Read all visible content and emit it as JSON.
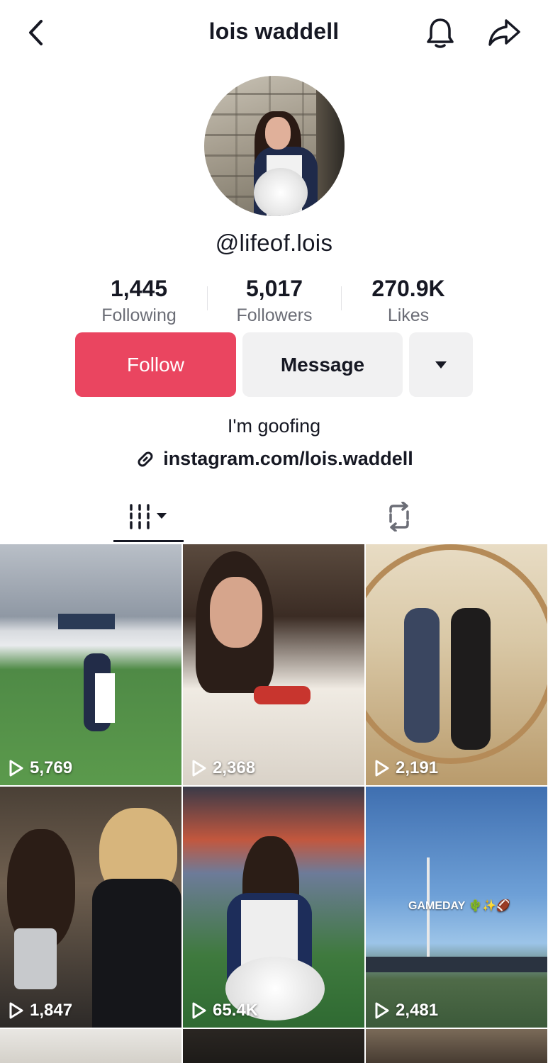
{
  "header": {
    "title": "lois waddell",
    "back_icon": "chevron-left-icon",
    "bell_icon": "bell-icon",
    "share_icon": "share-arrow-icon"
  },
  "profile": {
    "handle": "@lifeof.lois",
    "bio": "I'm goofing",
    "link": "instagram.com/lois.waddell"
  },
  "stats": {
    "following": {
      "value": "1,445",
      "label": "Following"
    },
    "followers": {
      "value": "5,017",
      "label": "Followers"
    },
    "likes": {
      "value": "270.9K",
      "label": "Likes"
    }
  },
  "actions": {
    "follow_label": "Follow",
    "message_label": "Message",
    "more_icon": "caret-down-icon"
  },
  "tabs": {
    "videos_icon": "video-grid-icon",
    "repost_icon": "repost-icon"
  },
  "videos": [
    {
      "views": "5,769"
    },
    {
      "views": "2,368"
    },
    {
      "views": "2,191"
    },
    {
      "views": "1,847"
    },
    {
      "views": "65.4K"
    },
    {
      "views": "2,481",
      "caption": "GAMEDAY 🌵✨🏈"
    }
  ],
  "colors": {
    "follow_button": "#ea4560",
    "secondary_button": "#f1f1f2",
    "text_primary": "#161823",
    "text_secondary": "#6b6d76"
  }
}
